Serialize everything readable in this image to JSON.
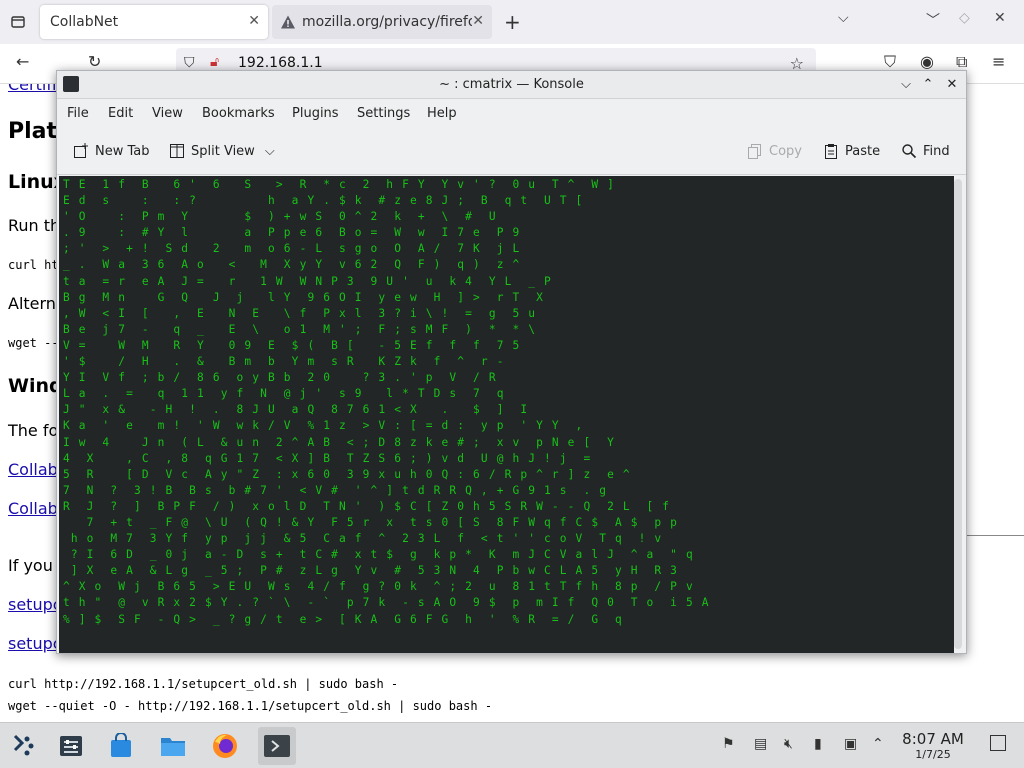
{
  "browser": {
    "tabs": [
      {
        "label": "CollabNet",
        "active": true
      },
      {
        "label": "mozilla.org/privacy/firefox",
        "active": false
      }
    ],
    "url": "192.168.1.1"
  },
  "page": {
    "link_cut": "Certifi",
    "heading_platform": "Plat",
    "heading_linux": "Linux",
    "text_run": "Run th",
    "code_curl_short": "curl ht",
    "text_altern": "Altern",
    "code_wget_short": "wget --",
    "heading_windows": "Wind",
    "text_the_fo": "The fo",
    "link_collab_1": "Collab",
    "link_collab_2": "Collab",
    "text_if_you": "If you",
    "link_setup_1": "setupc",
    "link_setup_2": "setupc",
    "code_curl": "curl http://192.168.1.1/setupcert_old.sh | sudo bash -",
    "code_wget": "wget --quiet -O - http://192.168.1.1/setupcert_old.sh | sudo bash -"
  },
  "konsole": {
    "title": "~ : cmatrix — Konsole",
    "menu": [
      "File",
      "Edit",
      "View",
      "Bookmarks",
      "Plugins",
      "Settings",
      "Help"
    ],
    "toolbar": {
      "new_tab": "New Tab",
      "split_view": "Split View",
      "copy": "Copy",
      "paste": "Paste",
      "find": "Find"
    },
    "matrix_lines": [
      "T E  1 f  B   6 '  6   S   >  R  * c  2  h F Y  Y v ' ?  0 u  T ^  W ]",
      "E d  s    :   : ?         h  a Y . $ k  # z e 8 J ;  B  q t  U T [",
      "' O    :  P m  Y       $  ) + w S  0 ^ 2  k  +  \\  #  U",
      ". 9    :  # Y  l       a  P p e 6  B o =  W  w  I 7 e  P 9",
      "; '  >  + !  S d   2   m  o 6 - L  s g o  O  A /  7 K  j L",
      "_ .  W a  3 6  A o   <   M  X y Y  v 6 2  Q  F )  q )  z ^",
      "t a  = r  e A  J =   r   1 W  W N P 3  9 U '  u  k 4  Y L  _ P",
      "B g  M n    G  Q   J  j   l Y  9 6 O I  y e w  H  ] >  r T  X",
      ", W  < I  [   ,  E   N  E   \\ f  P x l  3 ? i \\ !  =  g  5 u",
      "B e  j 7  -   q  _   E  \\   o 1  M ' ;  F ; s M F  )  *  * \\",
      "V =    W  M   R  Y   0 9  E  $ (  B [   - 5 E f  f  f  7 5",
      "' $    /  H   .  &   B m  b  Y m  s R   K Z k  f  ^  r -",
      "Y I  V f  ; b /  8 6  o y B b  2 0    ? 3 . ' p  V  / R",
      "L a  .  =   q  1 1  y f  N  @ j '  s 9   l * T D s  7  q",
      "J \"  x &   - H  !  .  8 J U  a Q  8 7 6 1 < X   .   $  ]  I",
      "K a  '  e   m !  ' W  w k / V  % 1 z  > V : [ = d :  y p  ' Y Y  ,",
      "I w  4    J n  ( L  & u n  2 ^ A B  < ; D 8 z k e # ;  x v  p N e [  Y",
      "4  X    , C  , 8  q G 1 7  < X ] B  T Z S 6 ; ) v d  U @ h J ! j  =",
      "5  R    [ D  V c  A y \" Z  : x 6 0  3 9 x u h 0 Q : 6 / R p ^ r ] z  e ^",
      "7  N  ?  3 ! B  B s  b # 7 '  < V #  ' ^ ] t d R R Q , + G 9 1 s  . g",
      "R  J  ?  ]  B P F  / )  x o l D  T N '  ) $ C [ Z 0 h 5 S R W - - Q  2 L  [ f",
      "   7  + t  _ F @  \\ U  ( Q ! & Y  F 5 r  x  t s 0 [ S  8 F W q f C $  A $  p p",
      " h o  M 7  3 Y f  y p  j j  & 5  C a f  ^  2 3 L  f  < t ' ' c o V  T q  ! v",
      " ? I  6 D  _ 0 j  a - D  s +  t C #  x t $  g  k p *  K  m J C V a l J  ^ a  \" q",
      " ] X  e A  & L g  _ 5 ;  P #  z L g  Y v  #  5 3 N  4  P b w C L A 5  y H  R 3",
      "^ X o  W j  B 6 5  > E U  W s  4 / f  g ? 0 k  ^ ; 2  u  8 1 t T f h  8 p  / P v",
      "t h \"  @  v R x 2 $ Y . ? ` \\  - `  p 7 k  - s A O  9 $  p  m I f  Q 0  T o  i 5 A",
      "% ] $  S F  - Q >  _ ? g / t  e >  [ K A  G 6 F G  h  '  % R  = /  G  q"
    ]
  },
  "taskbar": {
    "time": "8:07 AM",
    "date": "1/7/25",
    "tasks": [
      "application-launcher-icon",
      "settings-icon",
      "discover-store-icon",
      "file-manager-icon",
      "firefox-icon",
      "konsole-icon"
    ]
  }
}
